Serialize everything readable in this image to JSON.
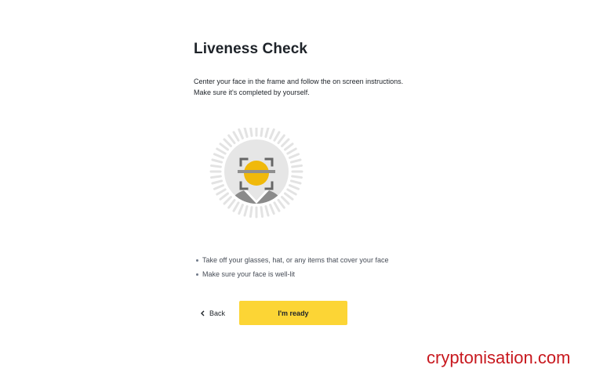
{
  "header": {
    "title": "Liveness Check"
  },
  "description": {
    "line1": "Center your face in the frame and follow the on screen instructions.",
    "line2": "Make sure it's completed by yourself."
  },
  "illustration": {
    "icon": "face-scan-icon",
    "accent_color": "#f0b90b"
  },
  "tips": [
    "Take off your glasses, hat, or any items that cover your face",
    "Make sure your face is well-lit"
  ],
  "actions": {
    "back_label": "Back",
    "ready_label": "I'm ready"
  },
  "watermark": {
    "text": "cryptonisation.com"
  },
  "colors": {
    "primary_button": "#fcd535",
    "text": "#1e2329",
    "watermark": "#c8191f"
  }
}
